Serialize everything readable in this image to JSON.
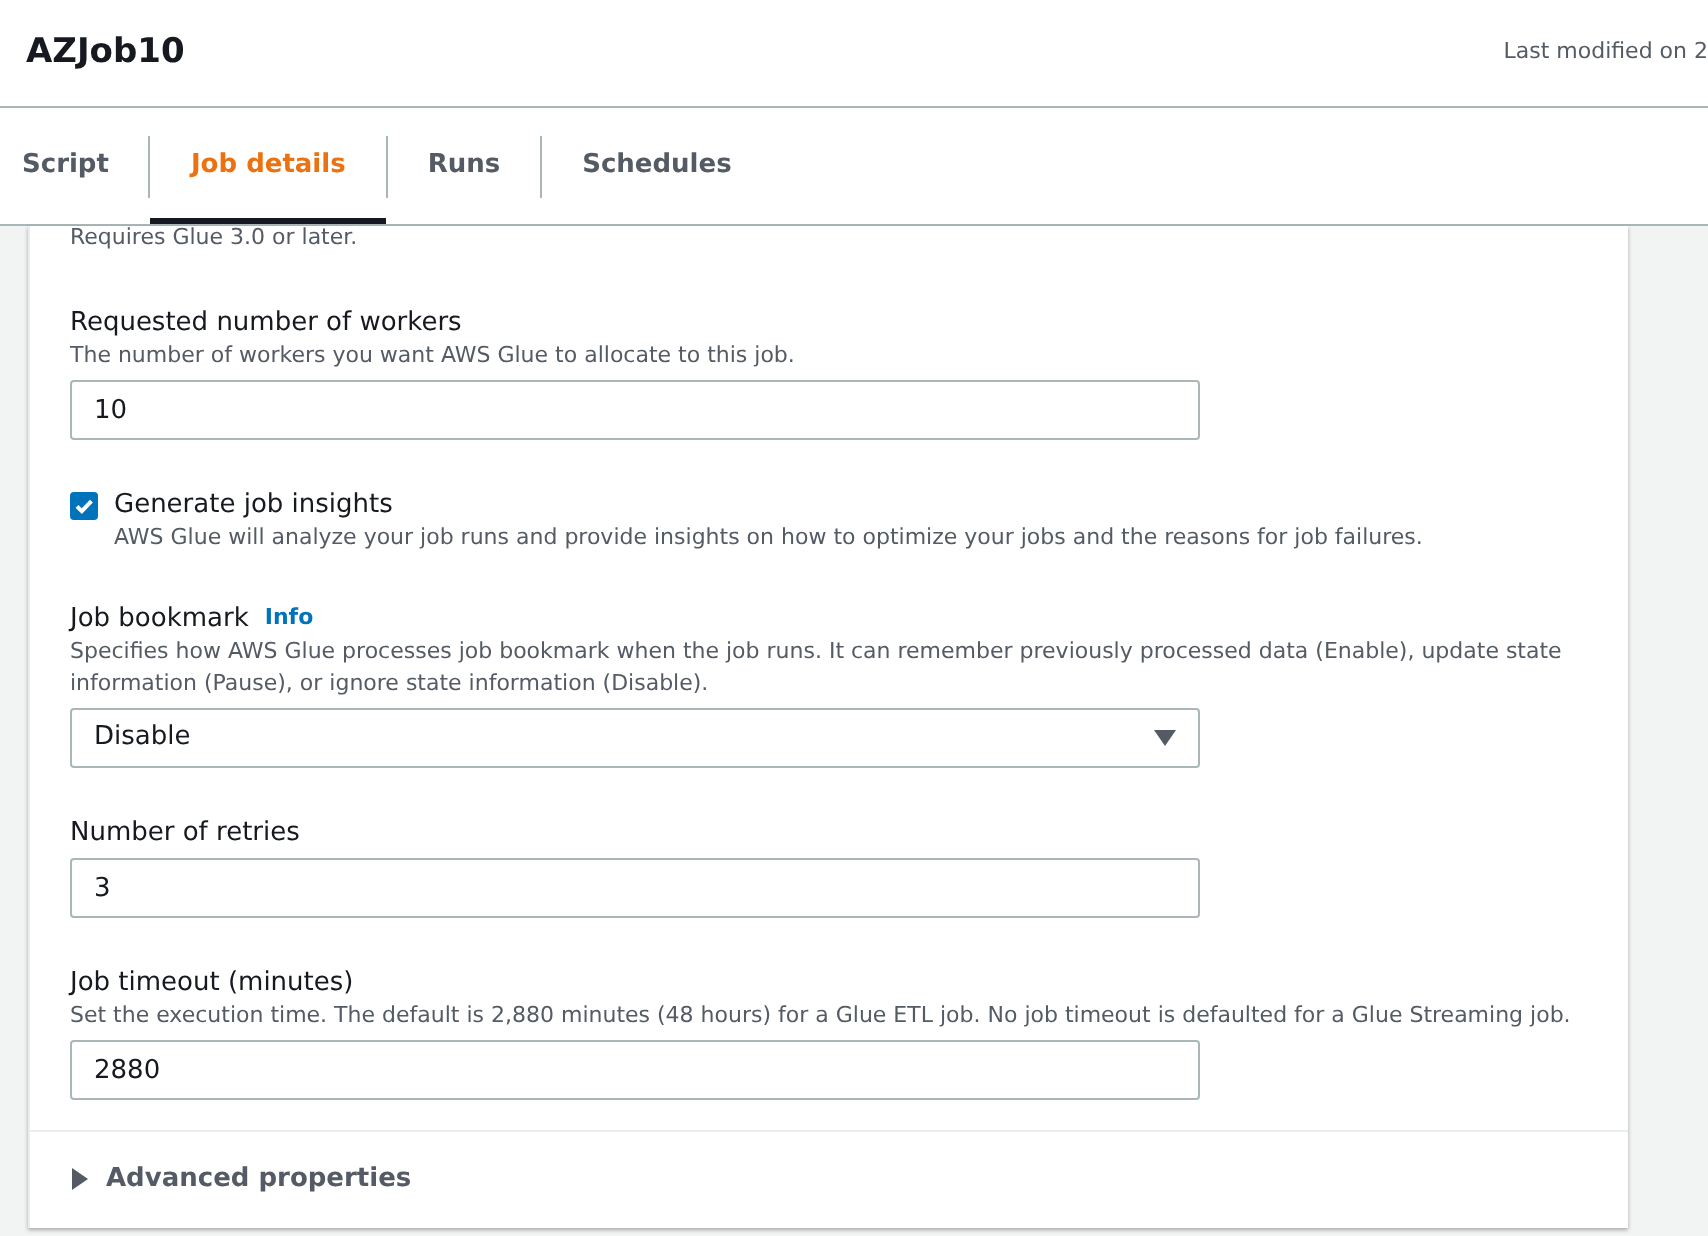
{
  "header": {
    "title": "AZJob10",
    "last_modified": "Last modified on 2"
  },
  "tabs": [
    {
      "label": "Script",
      "selected": false
    },
    {
      "label": "Job details",
      "selected": true
    },
    {
      "label": "Runs",
      "selected": false
    },
    {
      "label": "Schedules",
      "selected": false
    }
  ],
  "form": {
    "note": "Requires Glue 3.0 or later.",
    "fields": [
      {
        "kind": "input",
        "label": "Requested number of workers",
        "description": "The number of workers you want AWS Glue to allocate to this job.",
        "value": "10"
      },
      {
        "kind": "checkbox",
        "label": "Generate job insights",
        "description": "AWS Glue will analyze your job runs and provide insights on how to optimize your jobs and the reasons for job failures.",
        "checked": true
      },
      {
        "kind": "select",
        "label": "Job bookmark",
        "info": "Info",
        "description": "Specifies how AWS Glue processes job bookmark when the job runs. It can remember previously processed data (Enable), update state information (Pause), or ignore state information (Disable).",
        "value": "Disable"
      },
      {
        "kind": "input",
        "label": "Number of retries",
        "value": "3"
      },
      {
        "kind": "input",
        "label": "Job timeout (minutes)",
        "description": "Set the execution time. The default is 2,880 minutes (48 hours) for a Glue ETL job. No job timeout is defaulted for a Glue Streaming job.",
        "value": "2880"
      }
    ]
  },
  "advanced": {
    "label": "Advanced properties",
    "expanded": false
  }
}
